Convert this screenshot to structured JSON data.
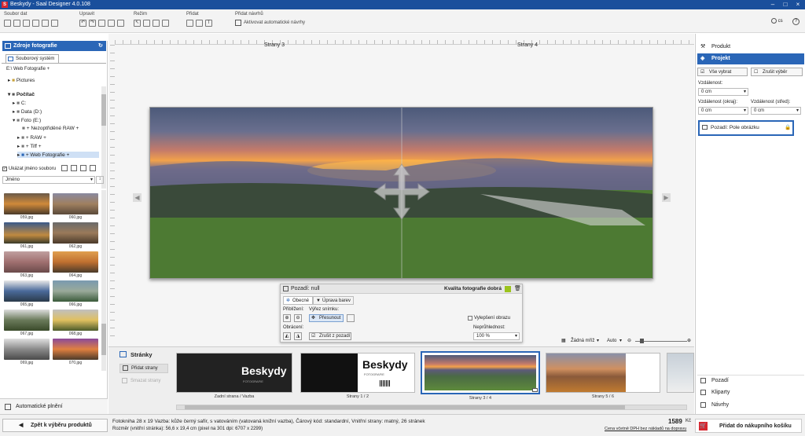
{
  "app": {
    "title": "Beskydy - Saal Designer 4.0.108"
  },
  "toolbar": {
    "groups": {
      "file": "Soubor dat",
      "edit": "Upravit",
      "mode": "Režim",
      "add": "Přidat",
      "suggest": "Přidat návrhů"
    },
    "auto_suggest_label": "Aktivovat automatické návrhy",
    "language": "cs"
  },
  "left": {
    "title": "Zdroje fotografie",
    "tab": "Souborový systém",
    "path": "E:\\ Web Fotografie +",
    "tree": [
      "Pictures",
      "Počítač",
      "C:",
      "Data (D:)",
      "Foto (E:)",
      "+ Nezoptřiděné RAW +",
      "+ RAW +",
      "+ Tiff +",
      "+ Web Fotografie +"
    ],
    "show_names": "Ukázat jméno souboru",
    "sort": "Jméno",
    "thumbs": [
      "059.jpg",
      "060.jpg",
      "061.jpg",
      "062.jpg",
      "063.jpg",
      "064.jpg",
      "065.jpg",
      "066.jpg",
      "067.jpg",
      "068.jpg",
      "069.jpg",
      "070.jpg"
    ],
    "auto_fill": "Automatické plnění"
  },
  "center": {
    "page_labels": [
      "Strany 3",
      "Strany 4"
    ],
    "float": {
      "title": "Pozadí: null",
      "quality": "Kvalita fotografie dobrá",
      "tab_general": "Obecné",
      "tab_color": "Úprava barev",
      "zoom_label": "Přiblížení:",
      "crop_label": "Výřez snímku:",
      "move_btn": "Přesunout",
      "improve": "Vylepšení obrazu",
      "flip_label": "Obrácení:",
      "remove_bg": "Zrušit z pozadí",
      "opacity_label": "Neprůhlednost:",
      "opacity_value": "100 %"
    },
    "zoom": {
      "mirror": "Žádná mříž",
      "auto": "Auto"
    }
  },
  "pages": {
    "header": "Stránky",
    "add": "Přidat strany",
    "remove": "Smazat strany",
    "labels": [
      "Zadní strana / Vazba",
      "Strany 1 / 2",
      "Strany 3 / 4",
      "Strany 5 / 6"
    ],
    "cover_text": "Beskydy",
    "cover_sub": "FOTOGRAFIE"
  },
  "right": {
    "product": "Produkt",
    "project": "Projekt",
    "select_all": "Vše vybrat",
    "deselect": "Zrušit výběr",
    "distance": "Vzdálenost:",
    "distance_val": "0 cm",
    "dist_edge": "Vzdálenost (okraj):",
    "dist_center": "Vzdálenost (střed):",
    "dist_edge_val": "0 cm",
    "dist_center_val": "0 cm",
    "bg_field": "Pozadí: Pole obrázku",
    "bottom": [
      "Pozadí",
      "Kliparty",
      "Návrhy"
    ]
  },
  "status": {
    "back": "Zpět k výběru produktů",
    "line1": "Fotokniha 28 x 19 Vazba: kůže černý safír, s vatováním (vatovaná knižní vazba), Čárový kód: standardní, Vnitřní strany: matný, 26 stránek",
    "line2": "Rozměr (vnitřní stránka): 56,6 x 19,4 cm (pixel na 301 dpi: 6707 x 2299)",
    "price": "1589",
    "currency": "Kč",
    "price_note": "Cena včetně DPH bez nákladů na dopravu",
    "cart": "Přidat do nákupního košíku"
  },
  "colors": {
    "titlebar": "#1a4f9c",
    "accent": "#2a66b7",
    "cart": "#d7262f"
  }
}
